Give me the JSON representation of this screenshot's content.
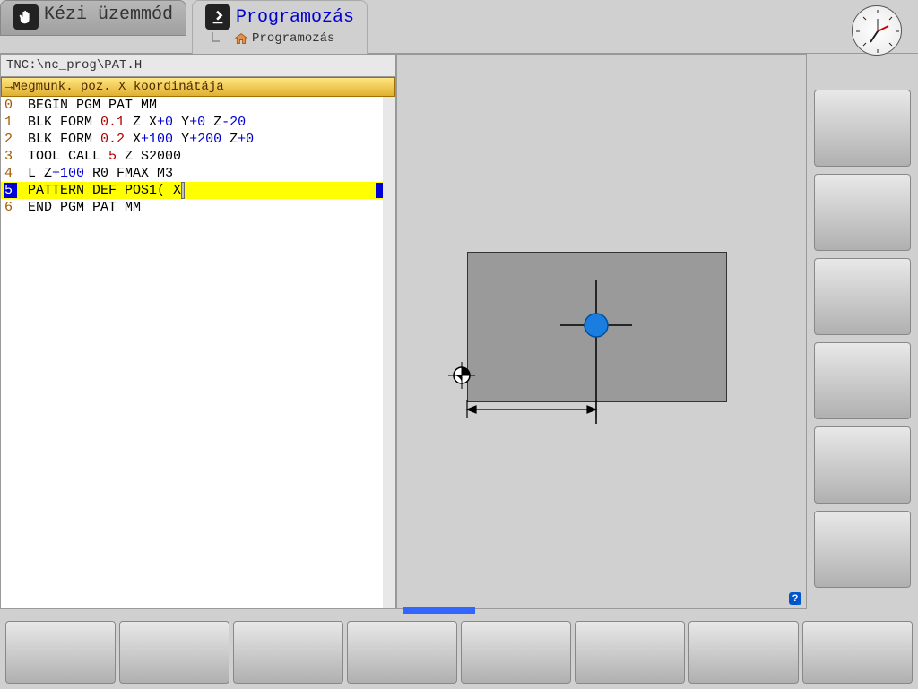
{
  "header": {
    "mode_tab_inactive": "Kézi üzemmód",
    "mode_tab_active": "Programozás",
    "breadcrumb": "Programozás"
  },
  "editor": {
    "path": "TNC:\\nc_prog\\PAT.H",
    "prompt": "→Megmunk. poz. X koordinátája",
    "lines": [
      {
        "n": "0",
        "text": "BEGIN PGM PAT MM"
      },
      {
        "n": "1",
        "text_parts": [
          "BLK FORM ",
          {
            "cls": "numv",
            "t": "0.1"
          },
          " Z X",
          {
            "cls": "plus",
            "t": "+0"
          },
          " Y",
          {
            "cls": "plus",
            "t": "+0"
          },
          " Z",
          {
            "cls": "plus",
            "t": "-20"
          }
        ]
      },
      {
        "n": "2",
        "text_parts": [
          "BLK FORM ",
          {
            "cls": "numv",
            "t": "0.2"
          },
          "  X",
          {
            "cls": "plus",
            "t": "+100"
          },
          "  Y",
          {
            "cls": "plus",
            "t": "+200"
          },
          "  Z",
          {
            "cls": "plus",
            "t": "+0"
          }
        ]
      },
      {
        "n": "3",
        "text_parts": [
          "TOOL CALL ",
          {
            "cls": "numv",
            "t": "5"
          },
          " Z S2000"
        ]
      },
      {
        "n": "4",
        "text_parts": [
          "L  Z",
          {
            "cls": "plus",
            "t": "+100"
          },
          " R0 FMAX M3"
        ]
      },
      {
        "n": "5",
        "selected": true,
        "text_parts": [
          "PATTERN DEF POS1(  X",
          {
            "cursor": true
          }
        ],
        "tail": " "
      },
      {
        "n": "6",
        "text": "END PGM PAT MM"
      }
    ]
  },
  "icons": {
    "hand": "hand-icon",
    "program": "program-icon",
    "home": "home-icon"
  },
  "help": "?"
}
